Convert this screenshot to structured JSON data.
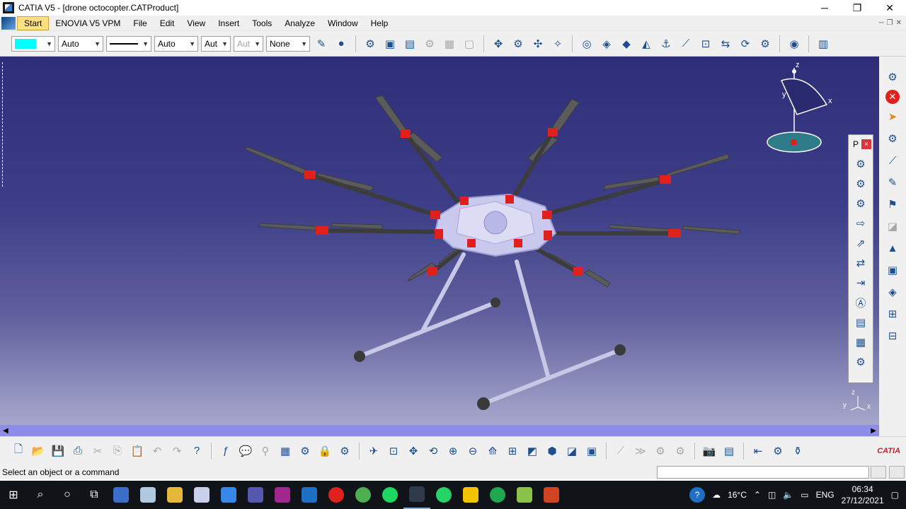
{
  "window": {
    "title": "CATIA V5 - [drone octocopter.CATProduct]",
    "minimize": "─",
    "maximize": "❐",
    "close": "✕"
  },
  "menu": {
    "items": [
      "Start",
      "ENOVIA V5 VPM",
      "File",
      "Edit",
      "View",
      "Insert",
      "Tools",
      "Analyze",
      "Window",
      "Help"
    ]
  },
  "toolbar_top": {
    "color_value": "",
    "transparency": "Auto",
    "linetype": "",
    "thickness": "Auto",
    "line_weight": "Aut",
    "point_symbol": "Aut",
    "layer": "None",
    "accent_color": "#00ffff"
  },
  "palette": {
    "title": "P",
    "close": "×"
  },
  "compass": {
    "x_label": "x",
    "y_label": "y",
    "z_label": "z"
  },
  "axis_triad": {
    "x_label": "x",
    "y_label": "y",
    "z_label": "z"
  },
  "scrollbar": {
    "left_arrow": "◀",
    "right_arrow": "▶"
  },
  "status": {
    "message": "Select an object or a command"
  },
  "branding": {
    "logo_text": "CATIA"
  },
  "taskbar": {
    "weather": "16°C",
    "language": "ENG",
    "time": "06:34",
    "date": "27/12/2021"
  },
  "colors": {
    "viewport_top": "#2e2e78",
    "viewport_bottom": "#a7a7cc",
    "highlight_red": "#e0201d",
    "scrollbar": "#8d8de8"
  }
}
